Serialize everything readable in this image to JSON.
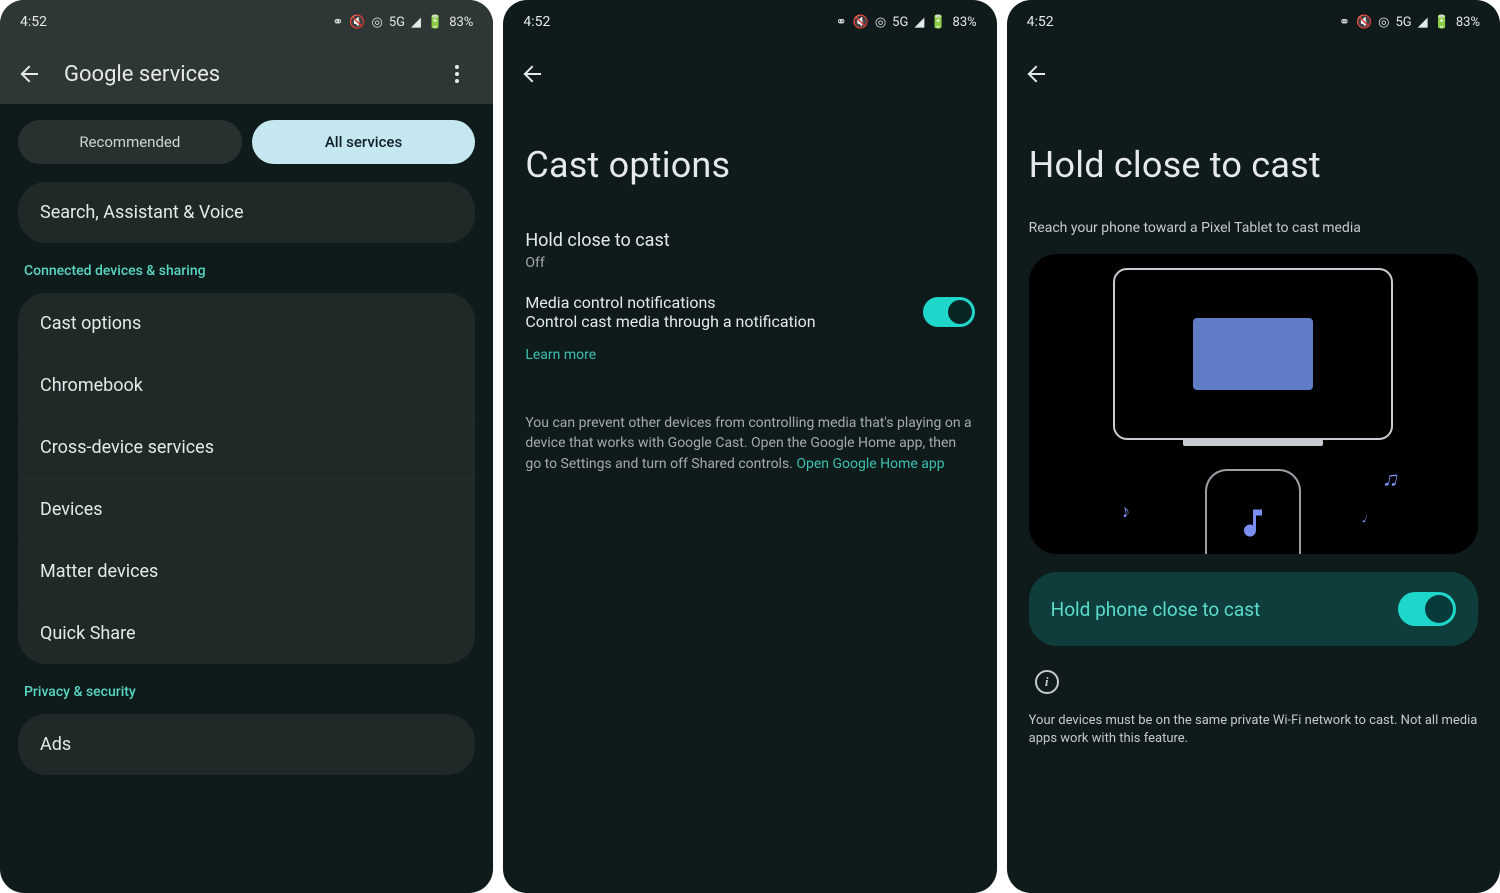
{
  "status": {
    "time": "4:52",
    "net": "5G",
    "battery": "83%"
  },
  "screen1": {
    "title": "Google services",
    "tabs": {
      "recommended": "Recommended",
      "all": "All services"
    },
    "search_card": "Search, Assistant & Voice",
    "section_connected": "Connected devices & sharing",
    "items": [
      "Cast options",
      "Chromebook",
      "Cross-device services",
      "Devices",
      "Matter devices",
      "Quick Share"
    ],
    "section_privacy": "Privacy & security",
    "items_privacy": [
      "Ads"
    ]
  },
  "screen2": {
    "title": "Cast options",
    "hold": {
      "title": "Hold close to cast",
      "sub": "Off"
    },
    "media": {
      "title": "Media control notifications",
      "sub": "Control cast media through a notification"
    },
    "learn_more": "Learn more",
    "body": "You can prevent other devices from controlling media that's playing on a device that works with Google Cast. Open the Google Home app, then go to Settings and turn off Shared controls. ",
    "open_app": "Open Google Home app"
  },
  "screen3": {
    "title": "Hold close to cast",
    "subtitle": "Reach your phone toward a Pixel Tablet to cast media",
    "toggle_label": "Hold phone close to cast",
    "info": "Your devices must be on the same private Wi-Fi network to cast. Not all media apps work with this feature."
  }
}
